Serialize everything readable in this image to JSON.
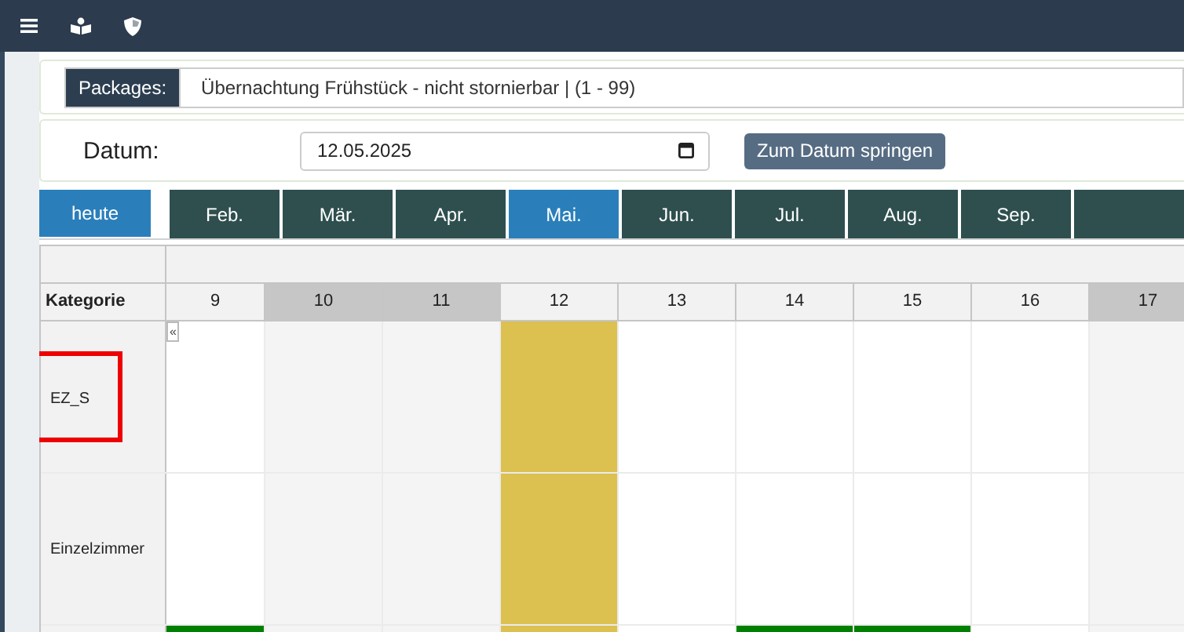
{
  "package_filter": {
    "label": "Packages:",
    "value": "Übernachtung Frühstück - nicht stornierbar | (1 - 99)"
  },
  "date_filter": {
    "label": "Datum:",
    "value": "12.05.2025",
    "button": "Zum Datum springen"
  },
  "today_button": "heute",
  "months": [
    {
      "label": "Feb.",
      "selected": false
    },
    {
      "label": "Mär.",
      "selected": false
    },
    {
      "label": "Apr.",
      "selected": false
    },
    {
      "label": "Mai.",
      "selected": true
    },
    {
      "label": "Jun.",
      "selected": false
    },
    {
      "label": "Jul.",
      "selected": false
    },
    {
      "label": "Aug.",
      "selected": false
    },
    {
      "label": "Sep.",
      "selected": false
    },
    {
      "selected": false
    }
  ],
  "table": {
    "category_header": "Kategorie",
    "prev_button": "«",
    "days": [
      {
        "label": "9",
        "weekend": false,
        "selected": false
      },
      {
        "label": "10",
        "weekend": true,
        "selected": false
      },
      {
        "label": "11",
        "weekend": true,
        "selected": false
      },
      {
        "label": "12",
        "weekend": false,
        "selected": true
      },
      {
        "label": "13",
        "weekend": false,
        "selected": false
      },
      {
        "label": "14",
        "weekend": false,
        "selected": false
      },
      {
        "label": "15",
        "weekend": false,
        "selected": false
      },
      {
        "label": "16",
        "weekend": false,
        "selected": false
      },
      {
        "label": "17",
        "weekend": true,
        "selected": false
      }
    ],
    "rows": [
      {
        "name": "EZ_S",
        "highlighted": true,
        "booked": [
          false,
          false,
          false,
          false,
          false,
          false,
          false,
          false,
          false
        ]
      },
      {
        "name": "Einzelzimmer",
        "highlighted": false,
        "booked": [
          false,
          false,
          false,
          false,
          false,
          false,
          false,
          false,
          false
        ]
      },
      {
        "booked": [
          true,
          false,
          false,
          false,
          false,
          true,
          true,
          false,
          false
        ]
      }
    ]
  }
}
